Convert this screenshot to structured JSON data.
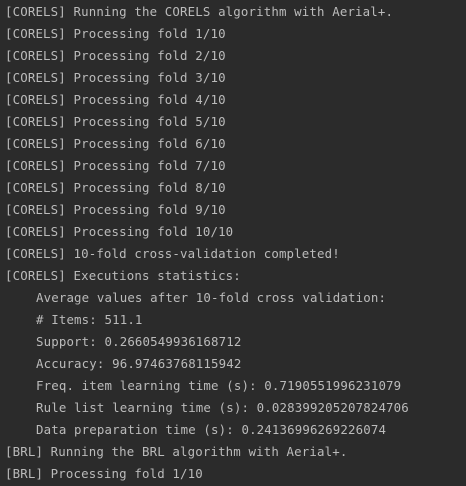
{
  "console": {
    "text_color": "#bbbbbb",
    "background": "#2b2b2b",
    "lines": [
      {
        "text": "[CORELS] Running the CORELS algorithm with Aerial+.",
        "indent": false
      },
      {
        "text": "[CORELS] Processing fold 1/10",
        "indent": false
      },
      {
        "text": "[CORELS] Processing fold 2/10",
        "indent": false
      },
      {
        "text": "[CORELS] Processing fold 3/10",
        "indent": false
      },
      {
        "text": "[CORELS] Processing fold 4/10",
        "indent": false
      },
      {
        "text": "[CORELS] Processing fold 5/10",
        "indent": false
      },
      {
        "text": "[CORELS] Processing fold 6/10",
        "indent": false
      },
      {
        "text": "[CORELS] Processing fold 7/10",
        "indent": false
      },
      {
        "text": "[CORELS] Processing fold 8/10",
        "indent": false
      },
      {
        "text": "[CORELS] Processing fold 9/10",
        "indent": false
      },
      {
        "text": "[CORELS] Processing fold 10/10",
        "indent": false
      },
      {
        "text": "[CORELS] 10-fold cross-validation completed!",
        "indent": false
      },
      {
        "text": "[CORELS] Executions statistics:",
        "indent": false
      },
      {
        "text": "Average values after 10-fold cross validation:",
        "indent": true
      },
      {
        "text": "# Items: 511.1",
        "indent": true
      },
      {
        "text": "Support: 0.2660549936168712",
        "indent": true
      },
      {
        "text": "Accuracy: 96.97463768115942",
        "indent": true
      },
      {
        "text": "Freq. item learning time (s): 0.7190551996231079",
        "indent": true
      },
      {
        "text": "Rule list learning time (s): 0.028399205207824706",
        "indent": true
      },
      {
        "text": "Data preparation time (s): 0.24136996269226074",
        "indent": true
      },
      {
        "text": "[BRL] Running the BRL algorithm with Aerial+.",
        "indent": false
      },
      {
        "text": "[BRL] Processing fold 1/10",
        "indent": false
      }
    ]
  }
}
